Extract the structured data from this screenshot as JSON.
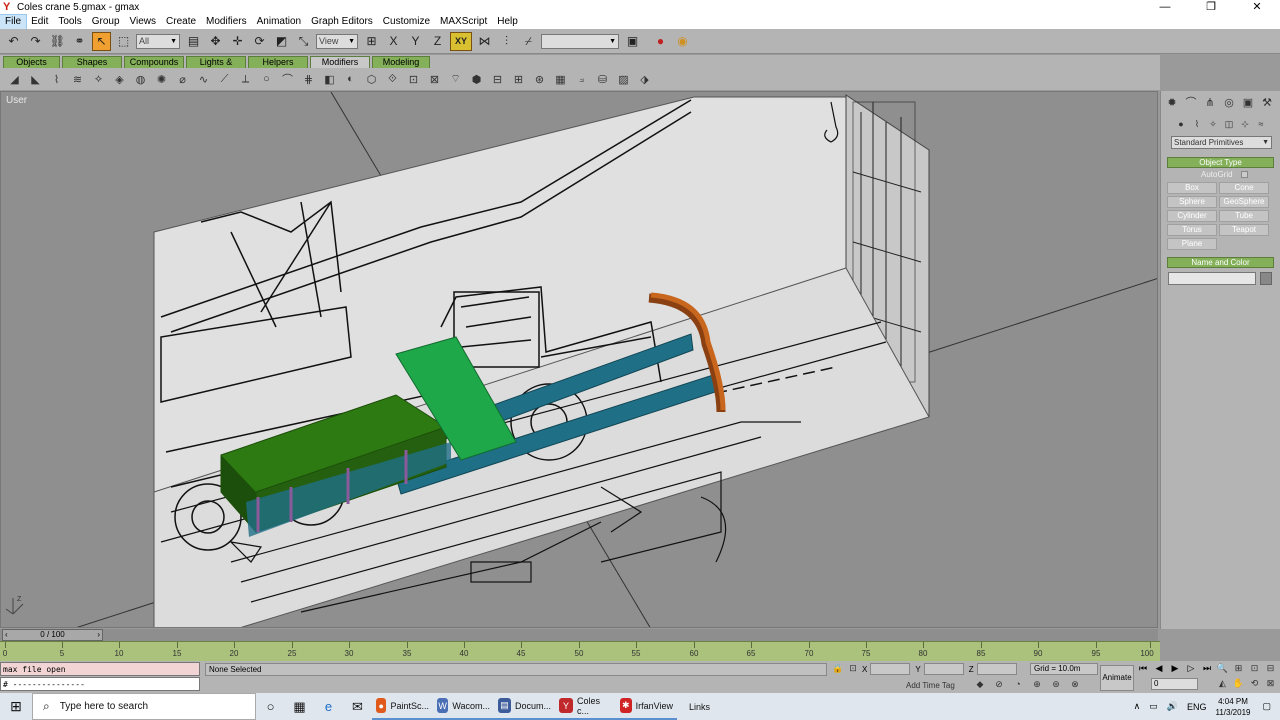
{
  "window": {
    "title": "Coles crane 5.gmax - gmax",
    "controls": [
      "—",
      "❐",
      "✕"
    ]
  },
  "menu": [
    "File",
    "Edit",
    "Tools",
    "Group",
    "Views",
    "Create",
    "Modifiers",
    "Animation",
    "Graph Editors",
    "Customize",
    "MAXScript",
    "Help"
  ],
  "toolbar": {
    "selection_filter": "All",
    "reference_coord": "View",
    "named_selection": "",
    "axis_constraint": "XY"
  },
  "tabs": [
    {
      "label": "Objects",
      "active": false
    },
    {
      "label": "Shapes",
      "active": false
    },
    {
      "label": "Compounds",
      "active": false
    },
    {
      "label": "Lights & Cameras",
      "active": false
    },
    {
      "label": "Helpers",
      "active": false
    },
    {
      "label": "Modifiers",
      "active": true
    },
    {
      "label": "Modeling",
      "active": false
    }
  ],
  "viewport": {
    "label": "User"
  },
  "command_panel": {
    "category_dropdown": "Standard Primitives",
    "object_type_title": "Object Type",
    "autogrid_label": "AutoGrid",
    "primitives": [
      "Box",
      "Cone",
      "Sphere",
      "GeoSphere",
      "Cylinder",
      "Tube",
      "Torus",
      "Teapot",
      "Plane"
    ],
    "name_color_title": "Name and Color"
  },
  "timeline": {
    "slider_label": "0 / 100",
    "ticks": [
      "0",
      "5",
      "10",
      "15",
      "20",
      "25",
      "30",
      "35",
      "40",
      "45",
      "50",
      "55",
      "60",
      "65",
      "70",
      "75",
      "80",
      "85",
      "90",
      "95",
      "100"
    ]
  },
  "status": {
    "listener_top": "max file open",
    "listener_bottom": "# ---------------",
    "selection": "None Selected",
    "x_label": "X",
    "y_label": "Y",
    "z_label": "Z",
    "grid": "Grid = 10.0m",
    "add_time_tag": "Add Time Tag",
    "animate": "Animate",
    "current_frame": "0"
  },
  "taskbar": {
    "search_placeholder": "Type here to search",
    "apps": [
      {
        "label": "PaintSc...",
        "color": "#e05a1c"
      },
      {
        "label": "Wacom...",
        "color": "#4a6fb5"
      },
      {
        "label": "Docum...",
        "color": "#3c5b9a"
      },
      {
        "label": "Coles c...",
        "color": "#c0282c"
      },
      {
        "label": "IrfanView",
        "color": "#d02424"
      }
    ],
    "links": "Links",
    "language": "ENG",
    "time": "4:04 PM",
    "date": "11/3/2019"
  }
}
